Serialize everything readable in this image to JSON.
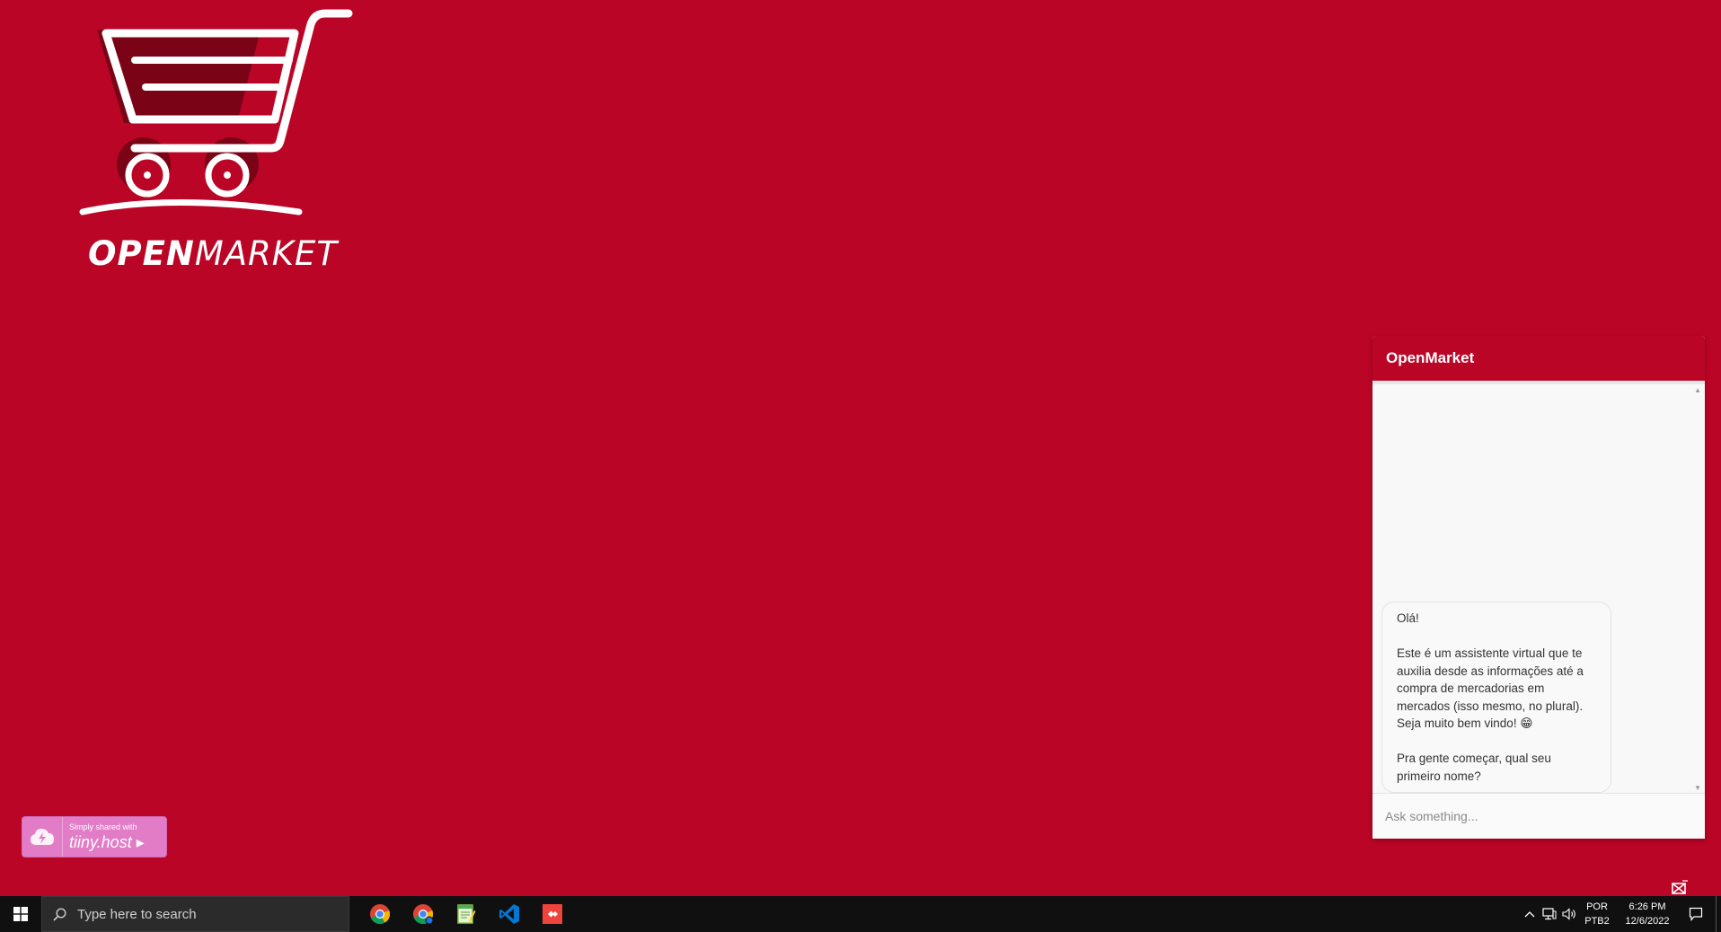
{
  "page": {
    "background_color": "#bb0526"
  },
  "logo": {
    "text_bold": "OPEN",
    "text_regular": "MARKET",
    "icon": "shopping-cart-icon"
  },
  "badge": {
    "subtitle": "Simply shared with",
    "title": "tiiny.host ▸",
    "color": "#e27cc7"
  },
  "chat": {
    "title": "OpenMarket",
    "accent_color": "#bb0526",
    "messages": [
      {
        "from": "bot",
        "text": "Olá!\n\nEste é um assistente virtual que te auxilia desde as informações até a compra de mercadorias em mercados (isso mesmo, no plural). Seja muito bem vindo! 😁\n\nPra gente começar, qual seu primeiro nome?"
      }
    ],
    "input_placeholder": "Ask something..."
  },
  "taskbar": {
    "search_placeholder": "Type here to search",
    "apps": [
      "chrome-icon",
      "chrome-canary-icon",
      "notepad-icon",
      "vscode-icon",
      "anydesk-icon"
    ],
    "language_line1": "POR",
    "language_line2": "PTB2",
    "time": "6:26 PM",
    "date": "12/6/2022"
  }
}
